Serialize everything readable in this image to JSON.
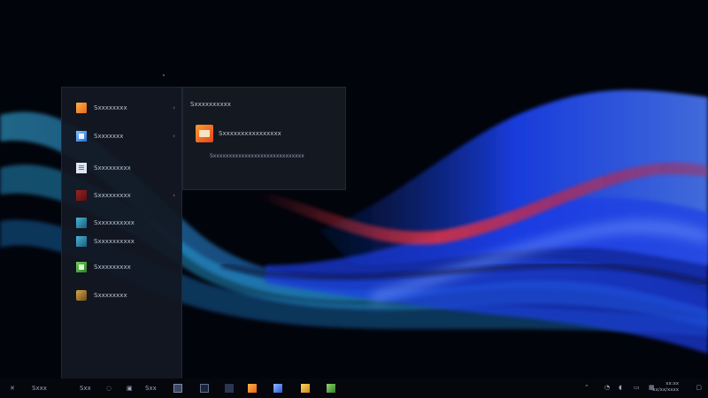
{
  "start_menu": {
    "items": [
      {
        "label": "Sxxxxxxxx",
        "icon": "orange-app-icon",
        "has_submenu": true
      },
      {
        "label": "Sxxxxxxx",
        "icon": "blue-app-icon",
        "has_submenu": true
      },
      {
        "label": "Sxxxxxxxxx",
        "icon": "document-icon",
        "has_submenu": false
      },
      {
        "label": "Sxxxxxxxxx",
        "icon": "red-app-icon",
        "has_submenu": true
      },
      {
        "label": "Sxxxxxxxxxx",
        "icon": "teal-app-icon",
        "has_submenu": false
      },
      {
        "label": "Sxxxxxxxxxx",
        "icon": "media-app-icon",
        "has_submenu": false
      },
      {
        "label": "Sxxxxxxxxx",
        "icon": "green-app-icon",
        "has_submenu": false
      },
      {
        "label": "Sxxxxxxxx",
        "icon": "tool-app-icon",
        "has_submenu": false
      }
    ]
  },
  "flyout": {
    "title": "Sxxxxxxxxxx",
    "app_label": "Sxxxxxxxxxxxxxxxx",
    "description": "Sxxxxxxxxxxxxxxxxxxxxxxxxxxxxx"
  },
  "taskbar": {
    "start_glyph": "✕",
    "search_label": "Sxxx",
    "items": [
      "Sxx",
      "◌",
      "▣",
      "Sxx"
    ],
    "clock_time": "xx:xx",
    "clock_date": "xx/xx/xxxx"
  },
  "colors": {
    "wave_blue": "#1f4fff",
    "wave_cyan": "#28a8e0",
    "wave_red": "#e02a3a",
    "background": "#02040c"
  }
}
